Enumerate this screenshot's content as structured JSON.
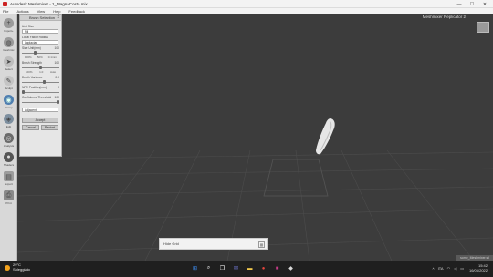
{
  "window": {
    "title": "Autodesk Meshmixer - 1_MagnaCosta.mix",
    "minimize": "—",
    "maximize": "☐",
    "close": "✕"
  },
  "menu": [
    "File",
    "Actions",
    "View",
    "Help",
    "Feedback"
  ],
  "toolbar": {
    "items": [
      {
        "label": "Import+",
        "icon": "plus-icon"
      },
      {
        "label": "Meshmix",
        "icon": "meshmix-icon"
      },
      {
        "label": "Select",
        "icon": "select-arrow-icon"
      },
      {
        "label": "Sculpt",
        "icon": "sculpt-brush-icon"
      },
      {
        "label": "Stamp",
        "icon": "stamp-globe-icon"
      },
      {
        "label": "Edit",
        "icon": "edit-icon"
      },
      {
        "label": "Analysis",
        "icon": "analysis-icon"
      },
      {
        "label": "Shaders",
        "icon": "shaders-icon"
      },
      {
        "label": "Export",
        "icon": "export-icon"
      },
      {
        "label": "Print",
        "icon": "print-icon"
      }
    ]
  },
  "panel": {
    "title": "Brush Selection",
    "close": "x",
    "unit_label": "Unit Size",
    "unit_value": "Fill",
    "falloff_label": "Local Falloff Radius",
    "falloff_value": "Laplacian",
    "rows": [
      {
        "label": "Size Unit(mm)",
        "value": "100",
        "level": 0.35,
        "sub": [
          "100%",
          "50%",
          "0.1mm"
        ]
      },
      {
        "label": "Brush Strength",
        "value": "100",
        "level": 0.5,
        "sub": [
          "100%",
          "1.0",
          "Auto"
        ]
      },
      {
        "label": "Depth Variance",
        "value": "0.0",
        "level": 0.6,
        "sub": []
      },
      {
        "label": "NFC Position(mm)",
        "value": "0",
        "level": 0.0,
        "sub": []
      },
      {
        "label": "Confidence Threshold",
        "value": "100",
        "level": 1.0,
        "sub": []
      }
    ],
    "mode_value": "Adjacent",
    "apply_label": "Accept",
    "cancel_label": "Cancel",
    "reset_label": "Restart"
  },
  "viewport": {
    "title": "Meshmixer Replicator 2",
    "status": "some_Meshmixer.stl"
  },
  "hint": {
    "text": "Hide Grid"
  },
  "taskbar": {
    "temperature": "29°C",
    "weather": "Soleggiato",
    "language": "ITA",
    "time": "15:42",
    "date": "16/06/2022",
    "apps": [
      {
        "name": "windows-start-icon",
        "glyph": "⊞",
        "color": "#3c8cf0"
      },
      {
        "name": "search-icon",
        "glyph": "⌕",
        "color": "#ffffff"
      },
      {
        "name": "task-view-icon",
        "glyph": "❐",
        "color": "#ffffff"
      },
      {
        "name": "chat-icon",
        "glyph": "✉",
        "color": "#7b83eb"
      },
      {
        "name": "file-explorer-icon",
        "glyph": "▬",
        "color": "#f2c94c"
      },
      {
        "name": "chrome-icon",
        "glyph": "●",
        "color": "#e8453c"
      },
      {
        "name": "app-icon-pink",
        "glyph": "■",
        "color": "#c43b87"
      },
      {
        "name": "meshmixer-icon",
        "glyph": "◆",
        "color": "#d8d8d8"
      }
    ]
  },
  "colors": {
    "viewport_bg": "#3c3c3c",
    "model": "#e6e6e6",
    "sun": "#f3a21c"
  }
}
